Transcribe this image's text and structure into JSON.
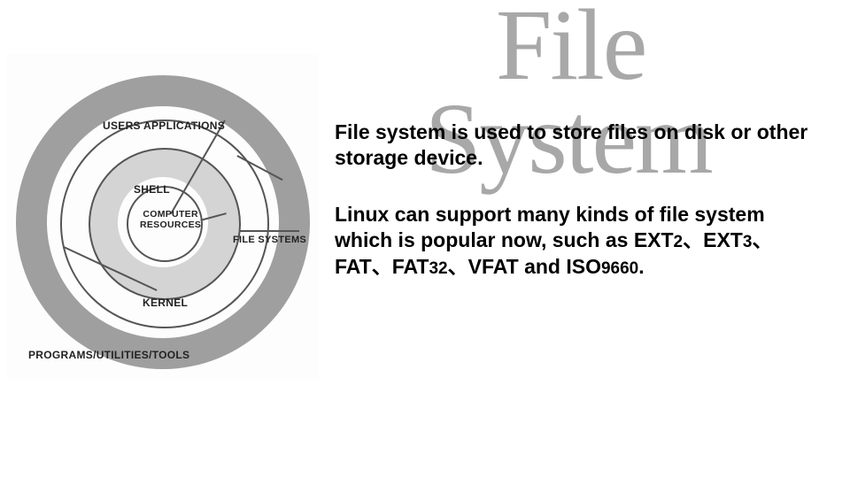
{
  "watermark": {
    "line1": "File",
    "line2": "System"
  },
  "diagram": {
    "labels": {
      "users_applications": "USERS APPLICATIONS",
      "shell": "SHELL",
      "file_systems": "FILE SYSTEMS",
      "computer_resources": "COMPUTER\nRESOURCES",
      "kernel": "KERNEL",
      "programs_utilities_tools": "PROGRAMS/UTILITIES/TOOLS"
    },
    "rings_outer_to_inner": [
      "USERS APPLICATIONS / PROGRAMS/UTILITIES/TOOLS",
      "SHELL",
      "FILE SYSTEMS / KERNEL",
      "COMPUTER RESOURCES"
    ]
  },
  "paragraphs": {
    "p1": "File system is used to store files on disk or other storage device.",
    "p2_prefix": "Linux can support many kinds of file system which is popular now, such as EXT",
    "p2_n1": "2",
    "p2_sep": "、",
    "p2_ext": "EXT",
    "p2_n2": "3",
    "p2_fat": "FAT",
    "p2_fat32": "FAT",
    "p2_n3": "32",
    "p2_vfat_iso": "VFAT and ISO",
    "p2_n4": "9660",
    "p2_period": "."
  }
}
